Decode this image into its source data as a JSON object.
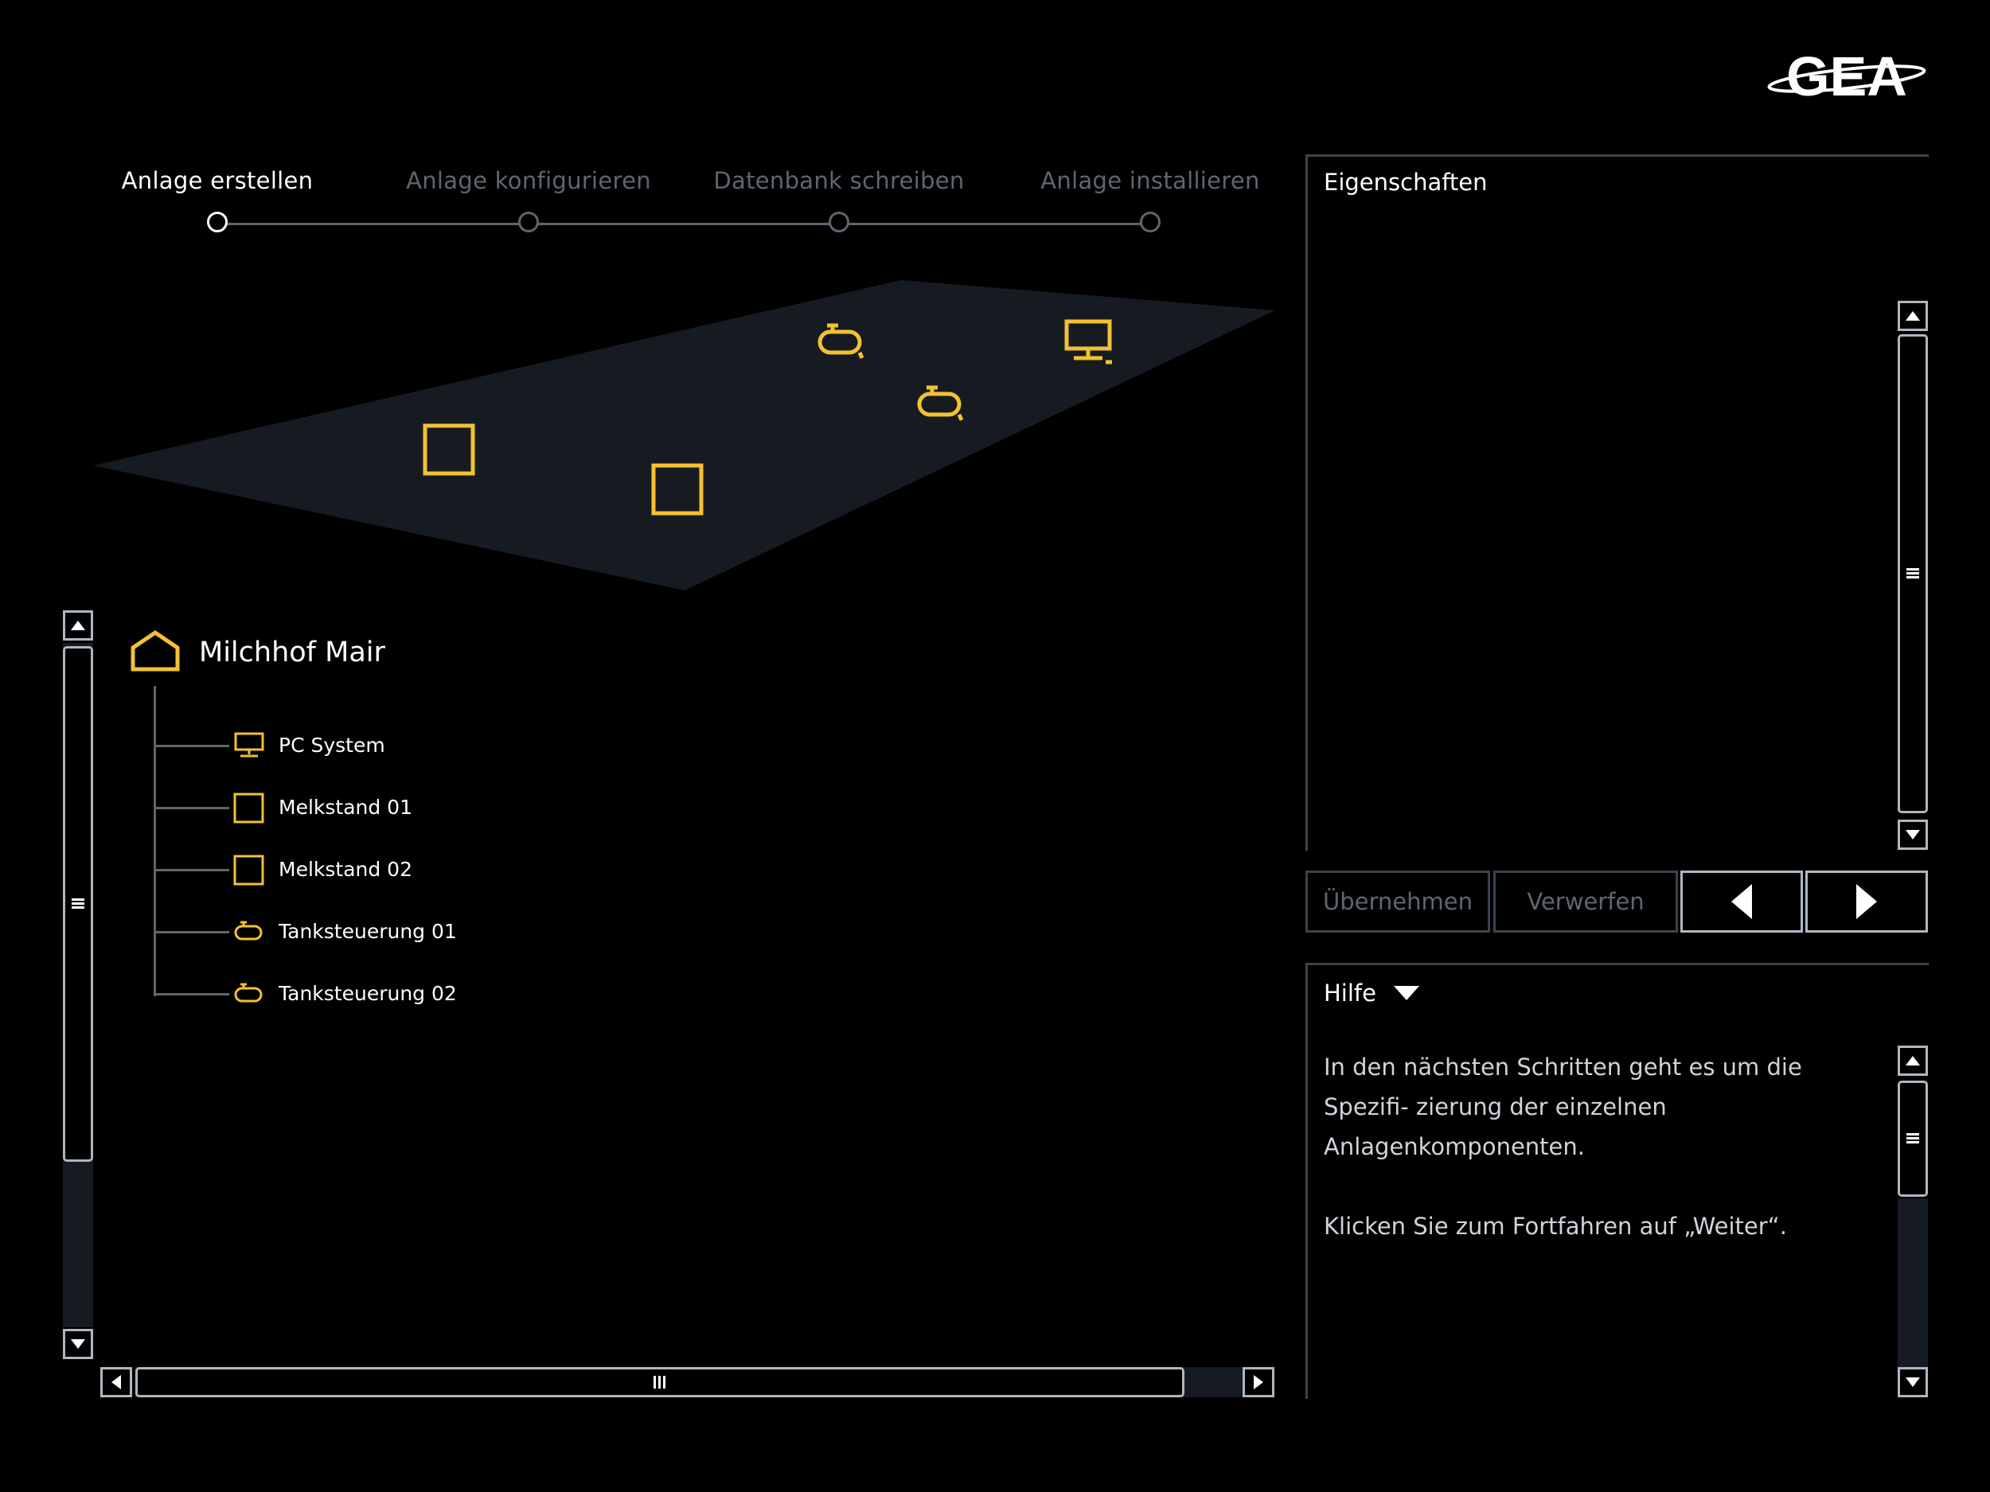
{
  "brand": {
    "logo_text": "GEA"
  },
  "stepper": {
    "steps": [
      {
        "label": "Anlage erstellen",
        "state": "active"
      },
      {
        "label": "Anlage konfigurieren",
        "state": "inactive"
      },
      {
        "label": "Datenbank schreiben",
        "state": "inactive"
      },
      {
        "label": "Anlage installieren",
        "state": "inactive"
      }
    ]
  },
  "layout_view": {
    "components": [
      {
        "type": "tank-icon"
      },
      {
        "type": "pc-icon"
      },
      {
        "type": "tank-icon"
      },
      {
        "type": "square-icon"
      },
      {
        "type": "square-icon"
      }
    ]
  },
  "tree": {
    "root": {
      "label": "Milchhof Mair",
      "icon": "house-icon"
    },
    "items": [
      {
        "label": "PC System",
        "icon": "pc-icon"
      },
      {
        "label": "Melkstand 01",
        "icon": "square-icon"
      },
      {
        "label": "Melkstand 02",
        "icon": "square-icon"
      },
      {
        "label": "Tanksteuerung 01",
        "icon": "tank-icon"
      },
      {
        "label": "Tanksteuerung 02",
        "icon": "tank-icon"
      }
    ]
  },
  "properties": {
    "title": "Eigenschaften"
  },
  "actions": {
    "apply_label": "Übernehmen",
    "discard_label": "Verwerfen",
    "prev_icon": "arrow-left-icon",
    "next_icon": "arrow-right-icon"
  },
  "help": {
    "title": "Hilfe",
    "paragraphs": [
      "In den nächsten Schritten geht es um die Spezifi- zierung der einzelnen Anlagenkomponenten.",
      "Klicken Sie zum Fortfahren auf „Weiter“."
    ]
  },
  "colors": {
    "background": "#000000",
    "accent": "#f2c230",
    "plane": "#161b22",
    "inactive_text": "#5d6670",
    "border": "#3b434c"
  }
}
